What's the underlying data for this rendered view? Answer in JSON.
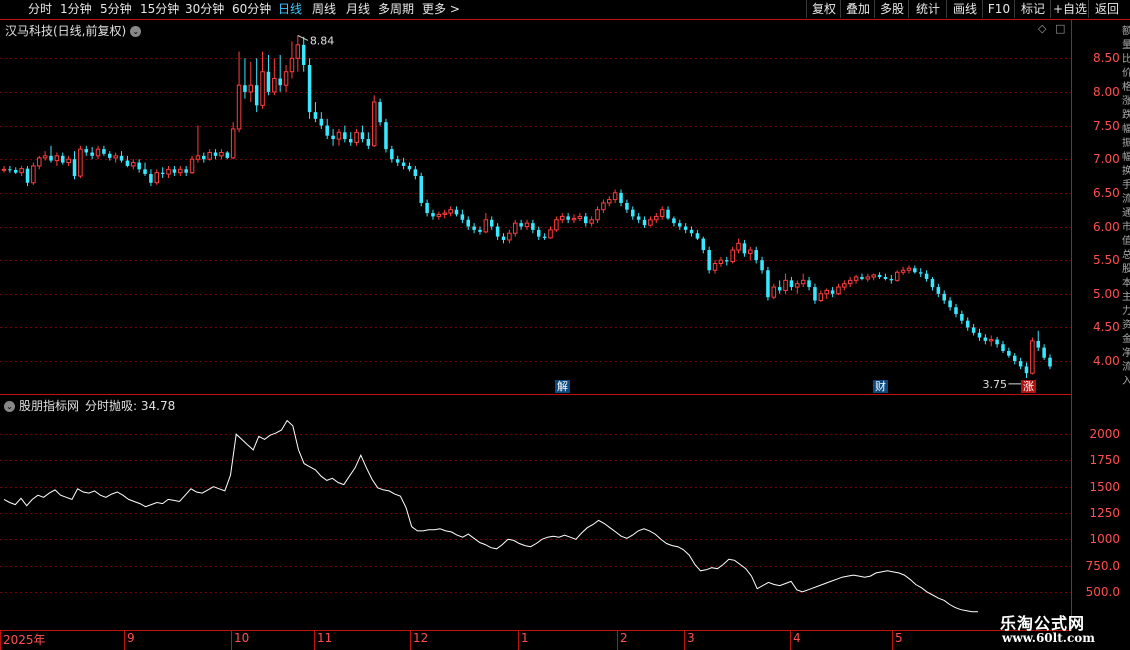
{
  "toolbar": {
    "timeframes": [
      "分时",
      "1分钟",
      "5分钟",
      "15分钟",
      "30分钟",
      "60分钟",
      "日线",
      "周线",
      "月线",
      "多周期",
      "更多 >"
    ],
    "active_timeframe": "日线",
    "buttons": [
      "复权",
      "叠加",
      "多股",
      "统计",
      "画线",
      "F10",
      "标记",
      "+自选",
      "返回"
    ]
  },
  "stock": {
    "title": "汉马科技(日线,前复权)",
    "dropdown_icon": "chevron-down-icon"
  },
  "indicator": {
    "title": "股朋指标网",
    "value_text": "分时抛吸: 34.78"
  },
  "price_axis": [
    "8.50",
    "8.00",
    "7.50",
    "7.00",
    "6.50",
    "6.00",
    "5.50",
    "5.00",
    "4.50",
    "4.00"
  ],
  "indicator_axis": [
    "2000",
    "1750",
    "1500",
    "1250",
    "1000",
    "750.0",
    "500.0"
  ],
  "time_axis": [
    "2025年",
    "9",
    "10",
    "11",
    "12",
    "1",
    "2",
    "3",
    "4",
    "5"
  ],
  "annotations": {
    "high": "8.84",
    "low": "3.75",
    "events": [
      "解",
      "财",
      "涨"
    ]
  },
  "watermark": {
    "name": "乐淘公式网",
    "url": "www.60lt.com"
  },
  "colors": {
    "up": "#ff3d3d",
    "down": "#38e8ff",
    "grid": "#7a0000",
    "axis": "#c01010",
    "line": "#ffffff",
    "active": "#3fc8ff"
  },
  "chart_data": [
    {
      "type": "candlestick",
      "title": "汉马科技(日线,前复权)",
      "ylim": [
        3.6,
        8.95
      ],
      "candles": [
        [
          6.85,
          6.9,
          6.8,
          6.85
        ],
        [
          6.85,
          6.9,
          6.8,
          6.84
        ],
        [
          6.84,
          6.88,
          6.78,
          6.8
        ],
        [
          6.8,
          6.9,
          6.75,
          6.86
        ],
        [
          6.86,
          6.9,
          6.6,
          6.65
        ],
        [
          6.65,
          6.95,
          6.62,
          6.9
        ],
        [
          6.9,
          7.05,
          6.85,
          7.02
        ],
        [
          7.02,
          7.12,
          6.98,
          7.05
        ],
        [
          7.05,
          7.2,
          6.95,
          6.98
        ],
        [
          6.98,
          7.1,
          6.9,
          7.05
        ],
        [
          7.05,
          7.1,
          6.92,
          6.95
        ],
        [
          6.95,
          7.05,
          6.9,
          7.0
        ],
        [
          7.0,
          7.12,
          6.7,
          6.75
        ],
        [
          6.75,
          7.2,
          6.72,
          7.15
        ],
        [
          7.15,
          7.2,
          7.05,
          7.1
        ],
        [
          7.1,
          7.18,
          7.0,
          7.05
        ],
        [
          7.05,
          7.2,
          7.0,
          7.15
        ],
        [
          7.15,
          7.2,
          7.05,
          7.08
        ],
        [
          7.08,
          7.12,
          6.98,
          7.02
        ],
        [
          7.02,
          7.1,
          6.95,
          7.05
        ],
        [
          7.05,
          7.12,
          6.95,
          6.98
        ],
        [
          6.98,
          7.05,
          6.88,
          6.9
        ],
        [
          6.9,
          7.0,
          6.85,
          6.95
        ],
        [
          6.95,
          7.0,
          6.8,
          6.85
        ],
        [
          6.85,
          6.95,
          6.75,
          6.78
        ],
        [
          6.78,
          6.85,
          6.6,
          6.65
        ],
        [
          6.65,
          6.85,
          6.62,
          6.8
        ],
        [
          6.8,
          6.88,
          6.72,
          6.78
        ],
        [
          6.78,
          6.9,
          6.72,
          6.85
        ],
        [
          6.85,
          6.9,
          6.75,
          6.8
        ],
        [
          6.8,
          6.9,
          6.75,
          6.85
        ],
        [
          6.85,
          6.9,
          6.75,
          6.8
        ],
        [
          6.8,
          7.05,
          6.78,
          7.0
        ],
        [
          7.0,
          7.5,
          6.95,
          7.05
        ],
        [
          7.05,
          7.1,
          6.95,
          7.0
        ],
        [
          7.0,
          7.15,
          6.98,
          7.1
        ],
        [
          7.1,
          7.15,
          7.0,
          7.05
        ],
        [
          7.05,
          7.15,
          7.0,
          7.1
        ],
        [
          7.1,
          7.12,
          7.0,
          7.02
        ],
        [
          7.02,
          7.55,
          7.0,
          7.45
        ],
        [
          7.45,
          8.6,
          7.4,
          8.1
        ],
        [
          8.1,
          8.5,
          7.9,
          8.0
        ],
        [
          8.0,
          8.45,
          7.85,
          8.1
        ],
        [
          8.1,
          8.5,
          7.7,
          7.8
        ],
        [
          7.8,
          8.6,
          7.75,
          8.3
        ],
        [
          8.3,
          8.55,
          7.95,
          8.0
        ],
        [
          8.0,
          8.5,
          7.95,
          8.2
        ],
        [
          8.2,
          8.55,
          8.0,
          8.1
        ],
        [
          8.1,
          8.4,
          8.0,
          8.3
        ],
        [
          8.3,
          8.75,
          8.2,
          8.5
        ],
        [
          8.5,
          8.84,
          8.3,
          8.7
        ],
        [
          8.7,
          8.82,
          8.3,
          8.4
        ],
        [
          8.4,
          8.5,
          7.6,
          7.7
        ],
        [
          7.7,
          7.85,
          7.55,
          7.6
        ],
        [
          7.6,
          7.7,
          7.45,
          7.5
        ],
        [
          7.5,
          7.6,
          7.3,
          7.35
        ],
        [
          7.35,
          7.45,
          7.2,
          7.3
        ],
        [
          7.3,
          7.45,
          7.2,
          7.4
        ],
        [
          7.4,
          7.5,
          7.25,
          7.3
        ],
        [
          7.3,
          7.4,
          7.2,
          7.25
        ],
        [
          7.25,
          7.45,
          7.2,
          7.4
        ],
        [
          7.4,
          7.5,
          7.25,
          7.3
        ],
        [
          7.3,
          7.4,
          7.15,
          7.2
        ],
        [
          7.2,
          7.95,
          7.18,
          7.85
        ],
        [
          7.85,
          7.9,
          7.5,
          7.55
        ],
        [
          7.55,
          7.6,
          7.1,
          7.15
        ],
        [
          7.15,
          7.2,
          6.95,
          7.0
        ],
        [
          7.0,
          7.05,
          6.9,
          6.95
        ],
        [
          6.95,
          7.02,
          6.85,
          6.9
        ],
        [
          6.9,
          6.95,
          6.82,
          6.85
        ],
        [
          6.85,
          6.9,
          6.7,
          6.75
        ],
        [
          6.75,
          6.8,
          6.3,
          6.35
        ],
        [
          6.35,
          6.4,
          6.15,
          6.2
        ],
        [
          6.2,
          6.25,
          6.1,
          6.15
        ],
        [
          6.15,
          6.22,
          6.1,
          6.18
        ],
        [
          6.18,
          6.25,
          6.12,
          6.2
        ],
        [
          6.2,
          6.3,
          6.15,
          6.25
        ],
        [
          6.25,
          6.3,
          6.15,
          6.18
        ],
        [
          6.18,
          6.25,
          6.05,
          6.1
        ],
        [
          6.1,
          6.15,
          5.95,
          6.0
        ],
        [
          6.0,
          6.05,
          5.9,
          5.95
        ],
        [
          5.95,
          6.0,
          5.88,
          5.92
        ],
        [
          5.92,
          6.2,
          5.9,
          6.1
        ],
        [
          6.1,
          6.15,
          5.95,
          6.0
        ],
        [
          6.0,
          6.05,
          5.8,
          5.85
        ],
        [
          5.85,
          5.9,
          5.75,
          5.8
        ],
        [
          5.8,
          5.95,
          5.75,
          5.9
        ],
        [
          5.9,
          6.1,
          5.85,
          6.05
        ],
        [
          6.05,
          6.1,
          5.95,
          6.0
        ],
        [
          6.0,
          6.1,
          5.95,
          6.05
        ],
        [
          6.05,
          6.1,
          5.9,
          5.95
        ],
        [
          5.95,
          6.0,
          5.8,
          5.85
        ],
        [
          5.85,
          5.9,
          5.8,
          5.83
        ],
        [
          5.83,
          6.0,
          5.82,
          5.95
        ],
        [
          5.95,
          6.15,
          5.92,
          6.1
        ],
        [
          6.1,
          6.2,
          6.05,
          6.15
        ],
        [
          6.15,
          6.2,
          6.05,
          6.1
        ],
        [
          6.1,
          6.18,
          6.05,
          6.12
        ],
        [
          6.12,
          6.2,
          6.08,
          6.15
        ],
        [
          6.15,
          6.2,
          6.0,
          6.05
        ],
        [
          6.05,
          6.15,
          6.0,
          6.1
        ],
        [
          6.1,
          6.3,
          6.05,
          6.25
        ],
        [
          6.25,
          6.4,
          6.2,
          6.35
        ],
        [
          6.35,
          6.45,
          6.3,
          6.4
        ],
        [
          6.4,
          6.55,
          6.35,
          6.5
        ],
        [
          6.5,
          6.55,
          6.3,
          6.35
        ],
        [
          6.35,
          6.4,
          6.2,
          6.25
        ],
        [
          6.25,
          6.3,
          6.1,
          6.15
        ],
        [
          6.15,
          6.2,
          6.05,
          6.1
        ],
        [
          6.1,
          6.15,
          5.98,
          6.02
        ],
        [
          6.02,
          6.15,
          6.0,
          6.1
        ],
        [
          6.1,
          6.2,
          6.05,
          6.15
        ],
        [
          6.15,
          6.3,
          6.1,
          6.25
        ],
        [
          6.25,
          6.3,
          6.1,
          6.12
        ],
        [
          6.12,
          6.15,
          6.0,
          6.05
        ],
        [
          6.05,
          6.1,
          5.95,
          6.0
        ],
        [
          6.0,
          6.05,
          5.9,
          5.95
        ],
        [
          5.95,
          6.0,
          5.85,
          5.9
        ],
        [
          5.9,
          5.95,
          5.8,
          5.82
        ],
        [
          5.82,
          5.85,
          5.6,
          5.65
        ],
        [
          5.65,
          5.7,
          5.3,
          5.35
        ],
        [
          5.35,
          5.5,
          5.3,
          5.45
        ],
        [
          5.45,
          5.55,
          5.4,
          5.5
        ],
        [
          5.5,
          5.55,
          5.42,
          5.48
        ],
        [
          5.48,
          5.7,
          5.45,
          5.65
        ],
        [
          5.65,
          5.82,
          5.6,
          5.75
        ],
        [
          5.75,
          5.8,
          5.55,
          5.6
        ],
        [
          5.6,
          5.7,
          5.5,
          5.65
        ],
        [
          5.65,
          5.7,
          5.45,
          5.5
        ],
        [
          5.5,
          5.55,
          5.3,
          5.35
        ],
        [
          5.35,
          5.4,
          4.9,
          4.95
        ],
        [
          4.95,
          5.15,
          4.92,
          5.1
        ],
        [
          5.1,
          5.2,
          5.0,
          5.05
        ],
        [
          5.05,
          5.3,
          5.0,
          5.2
        ],
        [
          5.2,
          5.25,
          5.05,
          5.1
        ],
        [
          5.1,
          5.2,
          5.0,
          5.15
        ],
        [
          5.15,
          5.3,
          5.1,
          5.2
        ],
        [
          5.2,
          5.25,
          5.05,
          5.1
        ],
        [
          5.1,
          5.15,
          4.85,
          4.9
        ],
        [
          4.9,
          5.05,
          4.88,
          5.0
        ],
        [
          5.0,
          5.08,
          4.92,
          5.05
        ],
        [
          5.05,
          5.1,
          4.95,
          5.0
        ],
        [
          5.0,
          5.15,
          4.98,
          5.1
        ],
        [
          5.1,
          5.2,
          5.05,
          5.15
        ],
        [
          5.15,
          5.25,
          5.1,
          5.2
        ],
        [
          5.2,
          5.28,
          5.15,
          5.25
        ],
        [
          5.25,
          5.3,
          5.2,
          5.22
        ],
        [
          5.22,
          5.3,
          5.18,
          5.25
        ],
        [
          5.25,
          5.3,
          5.2,
          5.28
        ],
        [
          5.28,
          5.32,
          5.22,
          5.25
        ],
        [
          5.25,
          5.3,
          5.2,
          5.22
        ],
        [
          5.22,
          5.28,
          5.15,
          5.2
        ],
        [
          5.2,
          5.35,
          5.18,
          5.32
        ],
        [
          5.32,
          5.4,
          5.28,
          5.35
        ],
        [
          5.35,
          5.42,
          5.3,
          5.38
        ],
        [
          5.38,
          5.42,
          5.3,
          5.32
        ],
        [
          5.32,
          5.38,
          5.25,
          5.3
        ],
        [
          5.3,
          5.35,
          5.18,
          5.22
        ],
        [
          5.22,
          5.25,
          5.05,
          5.1
        ],
        [
          5.1,
          5.15,
          4.95,
          5.0
        ],
        [
          5.0,
          5.05,
          4.85,
          4.9
        ],
        [
          4.9,
          4.95,
          4.75,
          4.8
        ],
        [
          4.8,
          4.85,
          4.65,
          4.7
        ],
        [
          4.7,
          4.75,
          4.55,
          4.6
        ],
        [
          4.6,
          4.65,
          4.45,
          4.5
        ],
        [
          4.5,
          4.55,
          4.38,
          4.42
        ],
        [
          4.42,
          4.48,
          4.3,
          4.35
        ],
        [
          4.35,
          4.4,
          4.25,
          4.3
        ],
        [
          4.3,
          4.38,
          4.22,
          4.32
        ],
        [
          4.32,
          4.36,
          4.2,
          4.25
        ],
        [
          4.25,
          4.3,
          4.12,
          4.15
        ],
        [
          4.15,
          4.2,
          4.05,
          4.08
        ],
        [
          4.08,
          4.12,
          3.95,
          4.0
        ],
        [
          4.0,
          4.05,
          3.88,
          3.92
        ],
        [
          3.92,
          3.98,
          3.75,
          3.82
        ],
        [
          3.82,
          4.35,
          3.8,
          4.3
        ],
        [
          4.3,
          4.45,
          4.15,
          4.2
        ],
        [
          4.2,
          4.25,
          4.02,
          4.05
        ],
        [
          4.05,
          4.1,
          3.88,
          3.92
        ]
      ]
    },
    {
      "type": "line",
      "title": "股朋指标网",
      "ylim": [
        280,
        2230
      ],
      "series": [
        {
          "values": [
            1380,
            1350,
            1330,
            1390,
            1320,
            1380,
            1420,
            1400,
            1440,
            1470,
            1420,
            1400,
            1380,
            1480,
            1450,
            1440,
            1460,
            1420,
            1400,
            1430,
            1450,
            1420,
            1380,
            1360,
            1340,
            1310,
            1330,
            1350,
            1340,
            1380,
            1370,
            1360,
            1420,
            1480,
            1450,
            1440,
            1470,
            1500,
            1480,
            1460,
            1610,
            2000,
            1950,
            1900,
            1850,
            1980,
            1950,
            1990,
            2010,
            2040,
            2130,
            2080,
            1850,
            1720,
            1690,
            1660,
            1600,
            1560,
            1580,
            1540,
            1520,
            1600,
            1680,
            1800,
            1680,
            1570,
            1490,
            1470,
            1460,
            1430,
            1410,
            1300,
            1120,
            1080,
            1080,
            1090,
            1090,
            1100,
            1080,
            1070,
            1040,
            1020,
            1050,
            1010,
            970,
            950,
            920,
            910,
            950,
            1000,
            990,
            960,
            940,
            930,
            960,
            1000,
            1020,
            1030,
            1020,
            1040,
            1020,
            1000,
            1060,
            1110,
            1140,
            1180,
            1150,
            1110,
            1070,
            1030,
            1010,
            1040,
            1080,
            1100,
            1080,
            1050,
            1000,
            960,
            940,
            930,
            900,
            850,
            760,
            700,
            710,
            730,
            720,
            760,
            810,
            800,
            760,
            720,
            650,
            530,
            560,
            590,
            570,
            560,
            580,
            600,
            520,
            500,
            520,
            540,
            560,
            580,
            600,
            620,
            640,
            650,
            660,
            650,
            640,
            650,
            680,
            690,
            700,
            690,
            680,
            660,
            620,
            570,
            540,
            500,
            470,
            440,
            420,
            380,
            350,
            330,
            320,
            310,
            310
          ]
        }
      ]
    }
  ]
}
